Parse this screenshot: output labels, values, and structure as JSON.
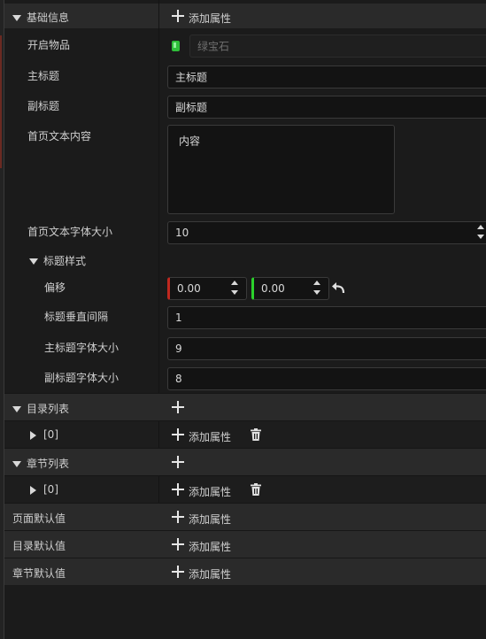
{
  "basic": {
    "title": "基础信息",
    "add_attr": "添加属性",
    "open_item_label": "开启物品",
    "open_item_value": "绿宝石",
    "main_title_label": "主标题",
    "main_title_value": "主标题",
    "sub_title_label": "副标题",
    "sub_title_value": "副标题",
    "home_text_label": "首页文本内容",
    "home_text_value": "内容",
    "home_font_label": "首页文本字体大小",
    "home_font_value": "10",
    "title_style": {
      "title": "标题样式",
      "offset_label": "偏移",
      "offset_x": "0.00",
      "offset_y": "0.00",
      "vgap_label": "标题垂直间隔",
      "vgap_value": "1",
      "main_font_label": "主标题字体大小",
      "main_font_value": "9",
      "sub_font_label": "副标题字体大小",
      "sub_font_value": "8"
    }
  },
  "catalog": {
    "title": "目录列表",
    "item": "[0]",
    "add_attr": "添加属性"
  },
  "chapters": {
    "title": "章节列表",
    "item": "[0]",
    "add_attr": "添加属性"
  },
  "defaults": [
    {
      "label": "页面默认值",
      "add_attr": "添加属性"
    },
    {
      "label": "目录默认值",
      "add_attr": "添加属性"
    },
    {
      "label": "章节默认值",
      "add_attr": "添加属性"
    }
  ],
  "colors": {
    "x_axis": "#c0281f",
    "y_axis": "#2bd12b",
    "gem": "#2fbf3a"
  }
}
